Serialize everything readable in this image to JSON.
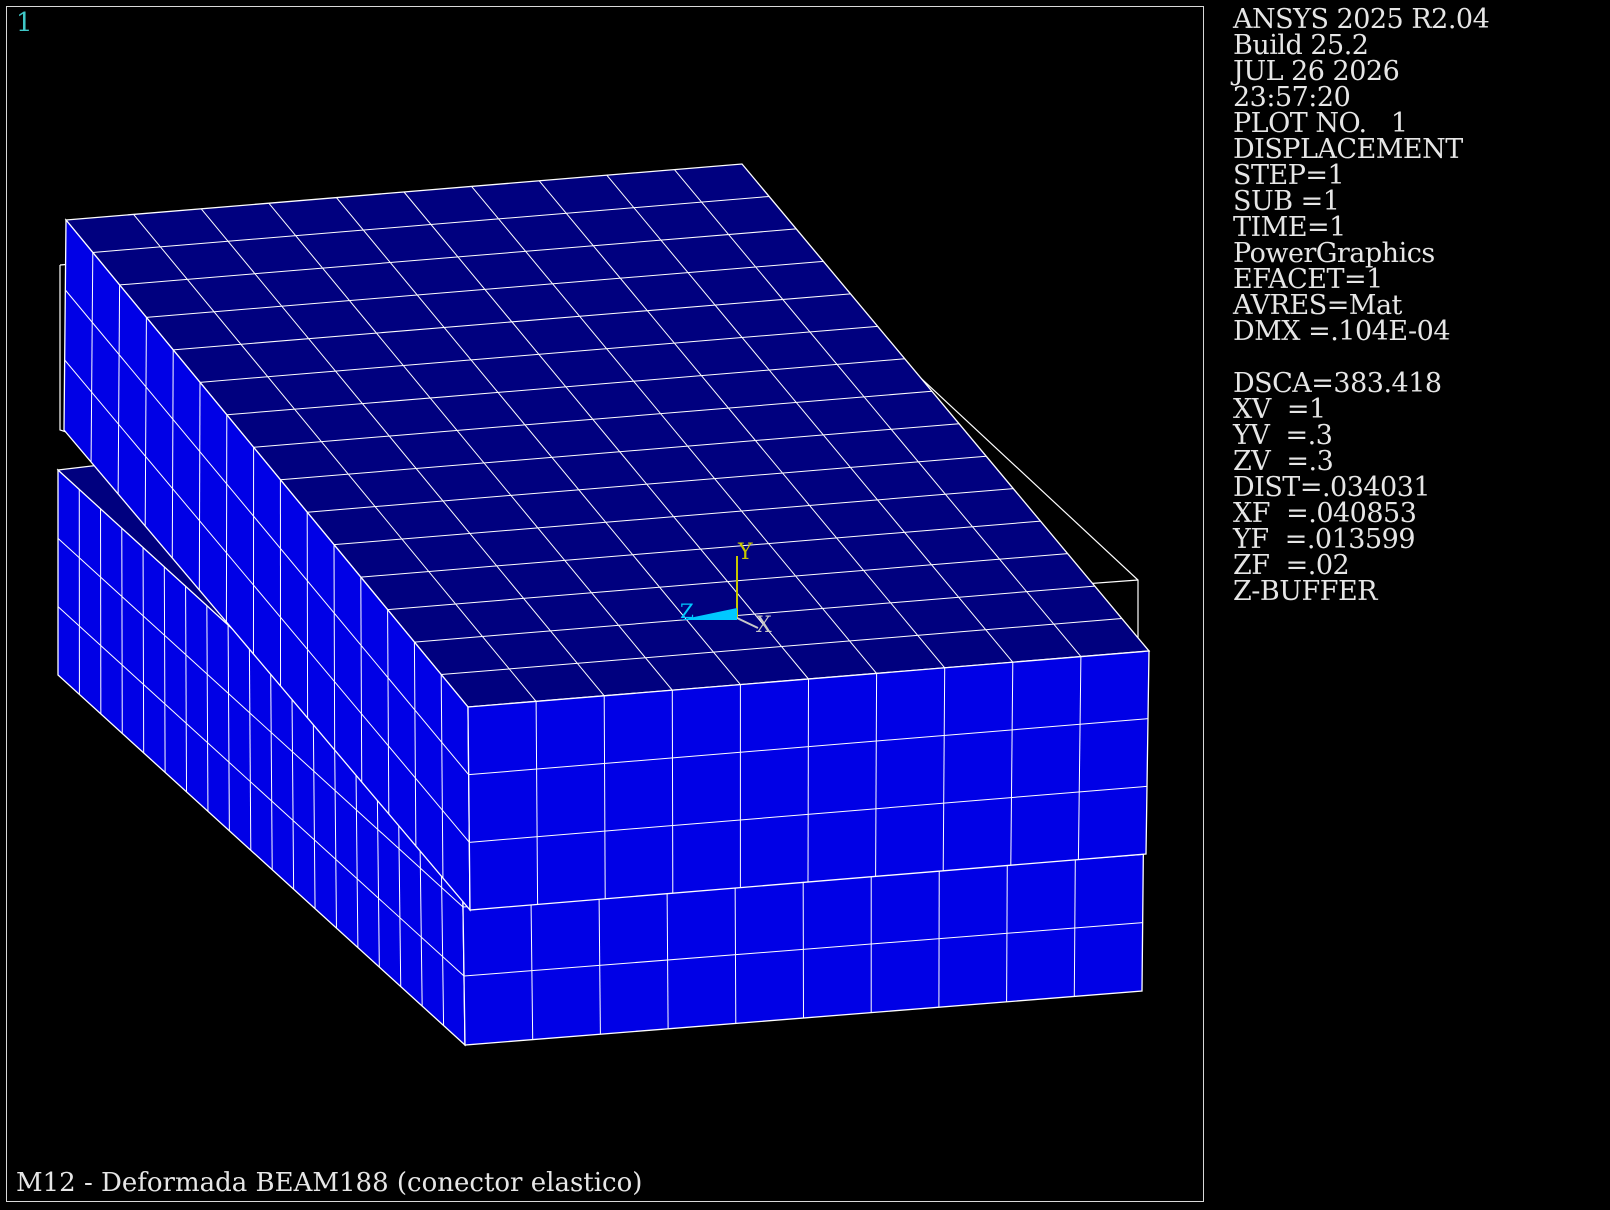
{
  "viewport": {
    "window_number": "1",
    "title": "M12 - Deformada BEAM188 (conector elastico)"
  },
  "legend": {
    "program": "ANSYS 2025 R2.04",
    "build": "Build 25.2",
    "date": "JUL 26 2026",
    "time": "23:57:20",
    "plot_no": "PLOT NO.   1",
    "plot_type": "DISPLACEMENT",
    "step": "STEP=1",
    "sub": "SUB =1",
    "time_value": "TIME=1",
    "graphics": "PowerGraphics",
    "efacet": "EFACET=1",
    "avres": "AVRES=Mat",
    "dmx": "DMX =.104E-04",
    "dsca": "DSCA=383.418",
    "xv": "XV  =1",
    "yv": "YV  =.3",
    "zv": "ZV  =.3",
    "dist": "DIST=.034031",
    "xf": "XF  =.040853",
    "yf": "YF  =.013599",
    "zf": "ZF  =.02",
    "zbuffer": "Z-BUFFER"
  },
  "triad": {
    "x": "X",
    "y": "Y",
    "z": "Z"
  },
  "colors": {
    "background": "#000000",
    "mesh_top": "#00007f",
    "mesh_side": "#0000e6",
    "mesh_lines": "#ffffff",
    "window_number": "#3fc8c8",
    "triad_y": "#c8c800",
    "triad_z": "#00c8ff"
  }
}
